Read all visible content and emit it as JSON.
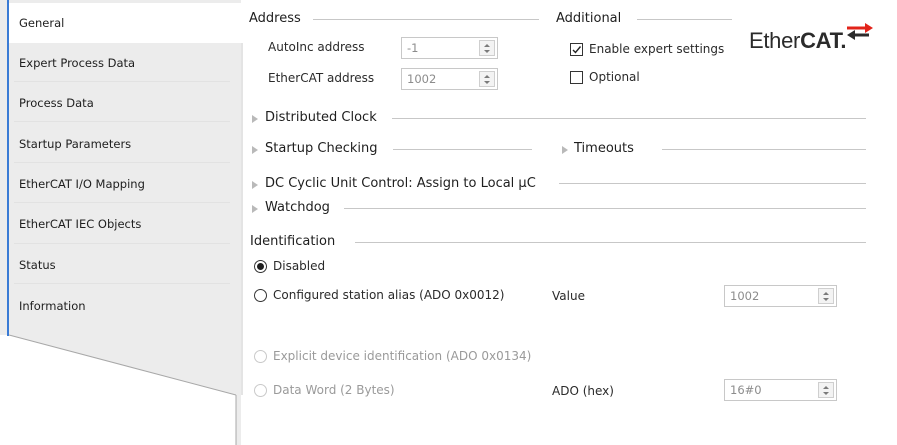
{
  "tabs": [
    {
      "label": "General",
      "active": true
    },
    {
      "label": "Expert Process Data"
    },
    {
      "label": "Process Data"
    },
    {
      "label": "Startup Parameters"
    },
    {
      "label": "EtherCAT I/O Mapping"
    },
    {
      "label": "EtherCAT IEC Objects"
    },
    {
      "label": "Status"
    },
    {
      "label": "Information"
    }
  ],
  "address": {
    "title": "Address",
    "autoinc_label": "AutoInc address",
    "autoinc_value": "-1",
    "ethercat_label": "EtherCAT address",
    "ethercat_value": "1002"
  },
  "additional": {
    "title": "Additional",
    "enable_expert_label": "Enable expert settings",
    "enable_expert_checked": true,
    "optional_label": "Optional",
    "optional_checked": false
  },
  "logo": {
    "part1": "Ether",
    "part2": "CAT.",
    "arrow_color": "#e2231a"
  },
  "sections": {
    "distributed_clock": "Distributed Clock",
    "startup_checking": "Startup Checking",
    "timeouts": "Timeouts",
    "dc_cyclic": "DC Cyclic Unit Control: Assign to Local µC",
    "watchdog": "Watchdog"
  },
  "identification": {
    "title": "Identification",
    "disabled_label": "Disabled",
    "configured_alias_label": "Configured station alias (ADO 0x0012)",
    "value_label": "Value",
    "value_value": "1002",
    "explicit_label": "Explicit device identification (ADO 0x0134)",
    "data_word_label": "Data Word (2 Bytes)",
    "ado_label": "ADO (hex)",
    "ado_value": "16#0",
    "selected": "Disabled"
  },
  "colors": {
    "accent": "#3a7bd5",
    "tab_bg": "#ececec"
  }
}
